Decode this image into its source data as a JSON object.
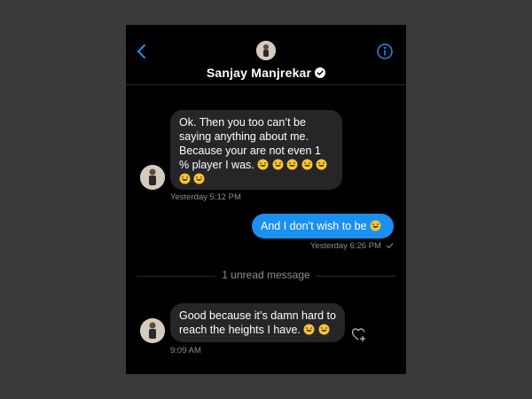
{
  "header": {
    "contact_name": "Sanjay Manjrekar",
    "back_icon": "chevron-left-icon",
    "info_icon": "info-circle-icon",
    "verified_icon": "verified-badge-icon"
  },
  "messages": [
    {
      "direction": "incoming",
      "text": "Ok. Then you too can’t be saying anything about me. Because your are not even 1 % player I was.",
      "emoji": "😂",
      "emoji_count": 7,
      "timestamp": "Yesterday 5:12 PM"
    },
    {
      "direction": "outgoing",
      "text": "And I don’t wish to be",
      "emoji": "😂",
      "emoji_count": 1,
      "timestamp": "Yesterday 6:26 PM"
    },
    {
      "direction": "incoming",
      "text": "Good because it’s damn hard to reach the heights I have.",
      "emoji": "😂",
      "emoji_count": 2,
      "timestamp": "9:09 AM"
    }
  ],
  "unread_divider": "1 unread message",
  "colors": {
    "background": "#000000",
    "incoming_bubble": "#262629",
    "outgoing_bubble": "#1a91f0",
    "accent": "#1a91f0",
    "timestamp": "#8e8e93"
  }
}
